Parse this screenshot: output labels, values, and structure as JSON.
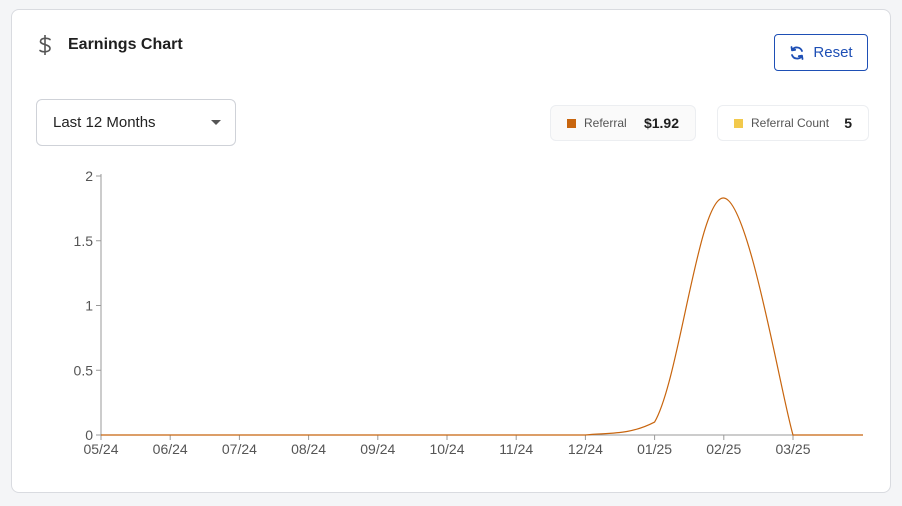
{
  "header": {
    "title": "Earnings Chart",
    "icon": "dollar-icon"
  },
  "reset_button": {
    "label": "Reset",
    "icon": "refresh-icon",
    "color": "#1e4fb5"
  },
  "period_select": {
    "selected": "Last 12 Months"
  },
  "stats": [
    {
      "label": "Referral",
      "value": "$1.92",
      "color": "#c8650e"
    },
    {
      "label": "Referral Count",
      "value": "5",
      "color": "#f2c94c"
    }
  ],
  "chart_data": {
    "type": "line",
    "x": [
      "05/24",
      "06/24",
      "07/24",
      "08/24",
      "09/24",
      "10/24",
      "11/24",
      "12/24",
      "01/25",
      "02/25",
      "03/25"
    ],
    "series": [
      {
        "values": [
          0,
          0,
          0,
          0,
          0,
          0,
          0,
          0,
          0.1,
          1.83,
          0
        ],
        "color": "#c8650e"
      }
    ],
    "yticks": [
      "0",
      "0.5",
      "1",
      "1.5",
      "2"
    ],
    "ylim": [
      0,
      2
    ],
    "grid": false
  }
}
